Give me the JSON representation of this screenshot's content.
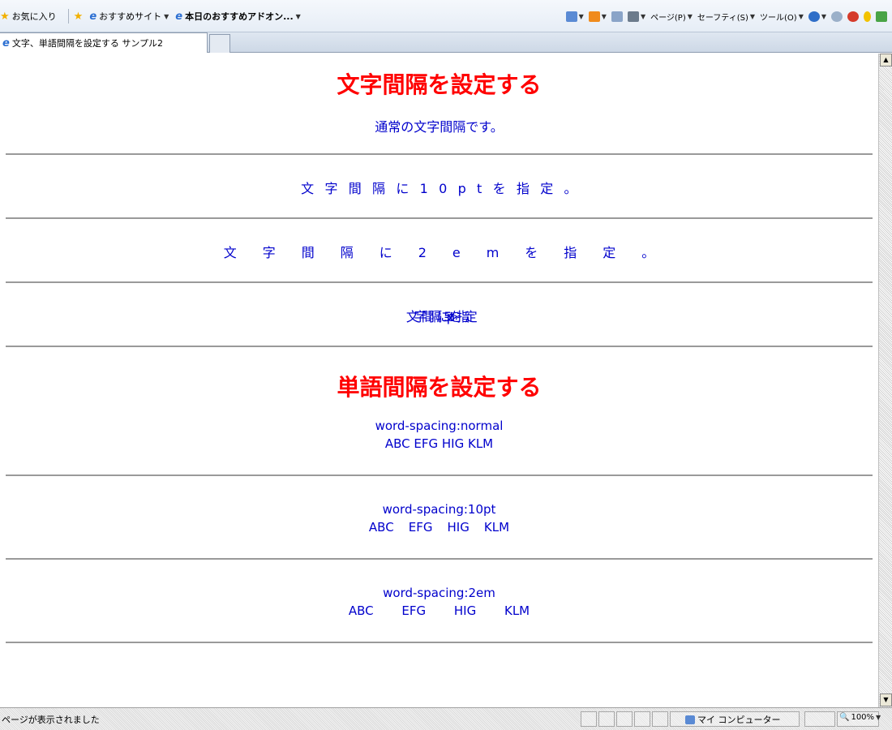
{
  "favorites_bar": {
    "favorites_label": "お気に入り",
    "suggested_sites": "おすすめサイト",
    "addons": "本日のおすすめアドオン..."
  },
  "command_bar": {
    "page": "ページ(P)",
    "safety": "セーフティ(S)",
    "tools": "ツール(O)"
  },
  "tab": {
    "title": "文字、単語間隔を設定する サンプル2"
  },
  "content": {
    "heading_letter": "文字間隔を設定する",
    "letter_normal": "通常の文字間隔です。",
    "letter_10pt": "文字間隔に10ptを指定。",
    "letter_2em": "文字間隔に2emを指定。",
    "letter_negative": "文字間隔に-5ptを指定",
    "heading_word": "単語間隔を設定する",
    "word_normal_label": "word-spacing:normal",
    "word_normal_sample": "ABC EFG HIG KLM",
    "word_10pt_label": "word-spacing:10pt",
    "word_10pt_sample": "ABC EFG HIG KLM",
    "word_2em_label": "word-spacing:2em",
    "word_2em_sample": "ABC EFG HIG KLM"
  },
  "status_bar": {
    "message": "ページが表示されました",
    "zone": "マイ コンピューター",
    "zoom": "100%"
  }
}
